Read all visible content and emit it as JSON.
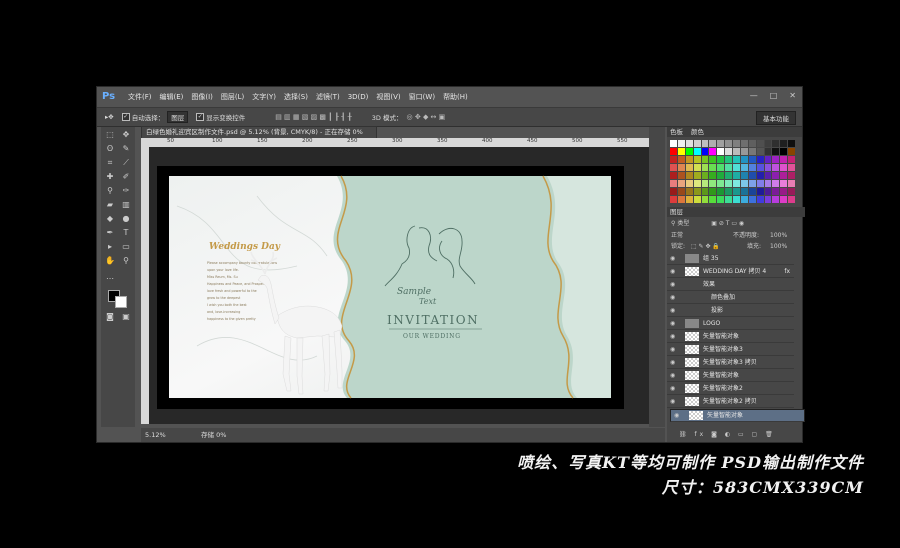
{
  "app": {
    "logo": "Ps"
  },
  "menu": [
    "文件(F)",
    "编辑(E)",
    "图像(I)",
    "图层(L)",
    "文字(Y)",
    "选择(S)",
    "滤镜(T)",
    "3D(D)",
    "视图(V)",
    "窗口(W)",
    "帮助(H)"
  ],
  "window_buttons": {
    "minimize": "—",
    "restore": "□",
    "close": "✕"
  },
  "options": {
    "auto_select": "自动选择：",
    "group": "图层",
    "show_transform": "显示变换控件",
    "mode3d": "3D 模式：",
    "workspace": "基本功能"
  },
  "document": {
    "tab_title": "白绿色婚礼迎宾区制作文件.psd @ 5.12% (背景, CMYK/8) - 正在存储 0%",
    "ruler_ticks": [
      "50",
      "100",
      "150",
      "200",
      "250",
      "300",
      "350",
      "400",
      "450",
      "500",
      "550"
    ],
    "zoom": "5.12%",
    "saving": "存储 0%"
  },
  "artwork": {
    "monogram": "Weddings Day",
    "body_lines": [
      "Please accompany bounty congratulations",
      "upon your love life.",
      "Miss Reum, Ms. Su",
      "Happiness and Peace, and Prosperity",
      "love fresh and powerful to the",
      "grow to the deepest",
      "I wish you both the best",
      "and, love-increasing",
      "happiness to the given pretty"
    ],
    "sample": "Sample",
    "text": "Text",
    "invitation": "INVITATION",
    "our_wedding": "OUR WEDDING"
  },
  "panels": {
    "swatches_tab": "色板",
    "color_tab": "颜色",
    "layers_tab": "图层",
    "filter_kind": "类型",
    "blend": "正常",
    "opacity_label": "不透明度:",
    "opacity": "100%",
    "lock_label": "锁定:",
    "fill_label": "填充:",
    "fill": "100%",
    "layers": [
      {
        "name": "组 35",
        "folder": true
      },
      {
        "name": "WEDDING DAY 拷贝 4",
        "fx": "fx"
      },
      {
        "name": "效果",
        "sub": 1
      },
      {
        "name": "颜色叠加",
        "sub": 2
      },
      {
        "name": "投影",
        "sub": 2
      },
      {
        "name": "LOGO",
        "folder": true
      },
      {
        "name": "矢量智能对象"
      },
      {
        "name": "矢量智能对象3"
      },
      {
        "name": "矢量智能对象3 拷贝"
      },
      {
        "name": "矢量智能对象"
      },
      {
        "name": "矢量智能对象2"
      },
      {
        "name": "矢量智能对象2 拷贝"
      },
      {
        "name": "矢量智能对象"
      }
    ]
  },
  "caption": {
    "line1": "喷绘、写真KT等均可制作 PSD输出制作文件",
    "line2": "尺寸：583CMX339CM"
  },
  "colors": {
    "mint": "#bcd6ca",
    "gold": "#c49a48",
    "deer": "#f4f4f4",
    "title_green": "#4f6f64"
  }
}
